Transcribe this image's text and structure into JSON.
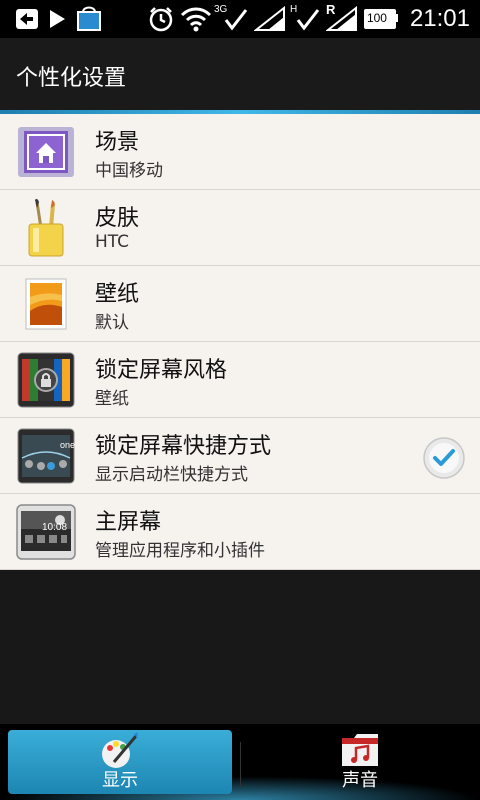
{
  "status_bar": {
    "time": "21:01",
    "battery": "100",
    "network_3g": "3G",
    "network_h": "H",
    "roaming": "R"
  },
  "title": "个性化设置",
  "items": [
    {
      "label": "场景",
      "sub": "中国移动"
    },
    {
      "label": "皮肤",
      "sub": "HTC"
    },
    {
      "label": "壁纸",
      "sub": "默认"
    },
    {
      "label": "锁定屏幕风格",
      "sub": "壁纸"
    },
    {
      "label": "锁定屏幕快捷方式",
      "sub": "显示启动栏快捷方式",
      "checked": true
    },
    {
      "label": "主屏幕",
      "sub": "管理应用程序和小插件"
    }
  ],
  "lockscreen_icon_text": "one",
  "homescreen_icon_text": "10:08",
  "bottom_nav": {
    "tabs": [
      {
        "label": "显示",
        "active": true
      },
      {
        "label": "声音",
        "active": false
      }
    ]
  },
  "colors": {
    "accent": "#40b7e8",
    "list_bg": "#f6f2ee",
    "check": "#2a9bd8"
  }
}
